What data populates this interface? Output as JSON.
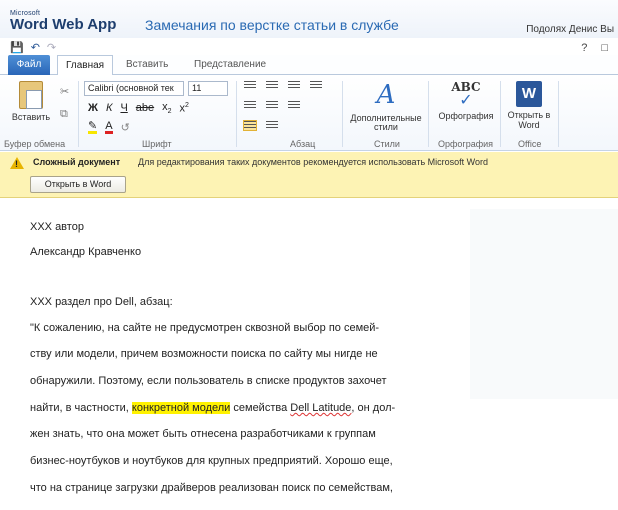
{
  "app": {
    "brand_small": "Microsoft",
    "brand_name": "Word Web App",
    "doc_title": "Замечания по верстке статьи в службе",
    "user": "Подолях Денис Вы"
  },
  "tabs": [
    {
      "label": "Файл"
    },
    {
      "label": "Главная"
    },
    {
      "label": "Вставить"
    },
    {
      "label": "Представление"
    }
  ],
  "ribbon": {
    "clipboard": {
      "paste_label": "Вставить",
      "group": "Буфер обмена"
    },
    "font": {
      "name": "Calibri (основной тек",
      "size": "11",
      "group": "Шрифт"
    },
    "paragraph": {
      "group": "Абзац"
    },
    "styles": {
      "button": "Дополнительные стили",
      "group": "Стили"
    },
    "spelling": {
      "button": "Орфография",
      "group": "Орфография"
    },
    "office": {
      "button": "Открыть в Word",
      "group": "Office"
    }
  },
  "infobar": {
    "title": "Сложный документ",
    "text": "Для редактирования таких документов рекомендуется использовать Microsoft Word",
    "button": "Открыть в Word",
    "icon_color": "#e8b400"
  },
  "document": {
    "lines": [
      "XXX автор",
      "Александр Кравченко",
      "XXX раздел про Dell, абзац:",
      "\"К сожалению, на сайте не предусмотрен сквозной выбор по семей-",
      "ству или модели, причем возможности поиска по сайту мы нигде не",
      "обнаружили. Поэтому, если пользователь в списке продуктов захочет",
      "найти, в частности, ",
      "конкретной модели",
      " семейства ",
      "Dell Latitude",
      ", он дол-",
      "жен знать, что она может быть отнесена разработчиками к группам",
      "бизнес-ноутбуков и ноутбуков для крупных предприятий. Хорошо еще,",
      "что на странице загрузки драйверов реализован поиск по семействам,"
    ]
  },
  "colors": {
    "accent": "#2a6ab3",
    "file_tab": "#2966b8",
    "infobar": "#fdf3b4",
    "highlight": "#fff200"
  }
}
